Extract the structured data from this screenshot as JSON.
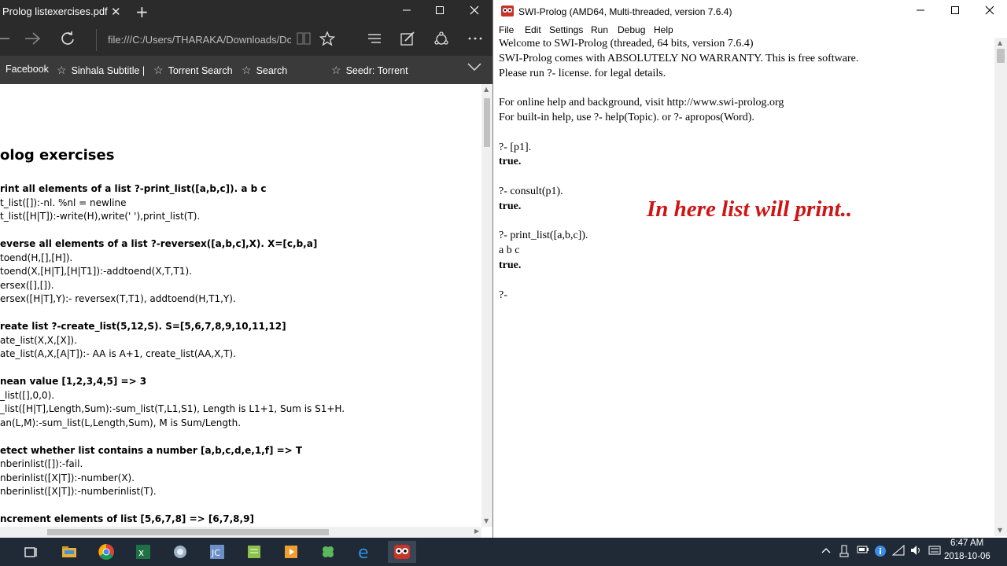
{
  "edge": {
    "tab_title": "Prolog listexercises.pdf",
    "tab_close": "✕",
    "new_tab": "+",
    "address": "file:///C:/Users/THARAKA/Downloads/Dc",
    "favorites": [
      {
        "label": "Facebook"
      },
      {
        "label": "Sinhala Subtitle |"
      },
      {
        "label": "Torrent Search"
      },
      {
        "label": "Search"
      },
      {
        "label": "Seedr: Torrent"
      }
    ],
    "document": {
      "title": "olog exercises",
      "lines": [
        {
          "text": "rint all elements of a list ?-print_list([a,b,c]). a b c",
          "bold": true
        },
        {
          "text": "t_list([]):-nl. %nl = newline",
          "bold": false
        },
        {
          "text": "t_list([H|T]):-write(H),write(' '),print_list(T).",
          "bold": false
        },
        {
          "text": "",
          "bold": false
        },
        {
          "text": "everse all elements of a list ?-reversex([a,b,c],X). X=[c,b,a]",
          "bold": true
        },
        {
          "text": "toend(H,[],[H]).",
          "bold": false
        },
        {
          "text": "toend(X,[H|T],[H|T1]):-addtoend(X,T,T1).",
          "bold": false
        },
        {
          "text": "ersex([],[]).",
          "bold": false
        },
        {
          "text": "ersex([H|T],Y):- reversex(T,T1), addtoend(H,T1,Y).",
          "bold": false
        },
        {
          "text": "",
          "bold": false
        },
        {
          "text": "reate list ?-create_list(5,12,S). S=[5,6,7,8,9,10,11,12]",
          "bold": true
        },
        {
          "text": "ate_list(X,X,[X]).",
          "bold": false
        },
        {
          "text": "ate_list(A,X,[A|T]):- AA is A+1, create_list(AA,X,T).",
          "bold": false
        },
        {
          "text": "",
          "bold": false
        },
        {
          "text": "nean value [1,2,3,4,5] => 3",
          "bold": true
        },
        {
          "text": "_list([],0,0).",
          "bold": false
        },
        {
          "text": "_list([H|T],Length,Sum):-sum_list(T,L1,S1), Length is L1+1, Sum is S1+H.",
          "bold": false
        },
        {
          "text": "an(L,M):-sum_list(L,Length,Sum), M is Sum/Length.",
          "bold": false
        },
        {
          "text": "",
          "bold": false
        },
        {
          "text": "etect whether list contains a number [a,b,c,d,e,1,f] => T",
          "bold": true
        },
        {
          "text": "nberinlist([]):-fail.",
          "bold": false
        },
        {
          "text": "nberinlist([X|T]):-number(X).",
          "bold": false
        },
        {
          "text": "nberinlist([X|T]):-numberinlist(T).",
          "bold": false
        },
        {
          "text": "",
          "bold": false
        },
        {
          "text": "ncrement elements of list [5,6,7,8] => [6,7,8,9]",
          "bold": true
        }
      ]
    }
  },
  "swi": {
    "title": "SWI-Prolog (AMD64, Multi-threaded, version 7.6.4)",
    "menu": [
      "File",
      "Edit",
      "Settings",
      "Run",
      "Debug",
      "Help"
    ],
    "console_lines": [
      {
        "text": "Welcome to SWI-Prolog (threaded, 64 bits, version 7.6.4)",
        "bold": false
      },
      {
        "text": "SWI-Prolog comes with ABSOLUTELY NO WARRANTY. This is free software.",
        "bold": false
      },
      {
        "text": "Please run ?- license. for legal details.",
        "bold": false
      },
      {
        "text": "",
        "bold": false
      },
      {
        "text": "For online help and background, visit http://www.swi-prolog.org",
        "bold": false
      },
      {
        "text": "For built-in help, use ?- help(Topic). or ?- apropos(Word).",
        "bold": false
      },
      {
        "text": "",
        "bold": false
      },
      {
        "text": "?- [p1].",
        "bold": false
      },
      {
        "text": "true.",
        "bold": true
      },
      {
        "text": "",
        "bold": false
      },
      {
        "text": "?- consult(p1).",
        "bold": false
      },
      {
        "text": "true.",
        "bold": true
      },
      {
        "text": "",
        "bold": false
      },
      {
        "text": "?- print_list([a,b,c]).",
        "bold": false
      },
      {
        "text": "a b c",
        "bold": false
      },
      {
        "text": "true.",
        "bold": true
      },
      {
        "text": "",
        "bold": false
      },
      {
        "text": "?-",
        "bold": false
      }
    ],
    "annotation": "In here list will print..",
    "annotation_color": "#d01414"
  },
  "taskbar": {
    "time": "6:47 AM",
    "date": "2018-10-06"
  }
}
